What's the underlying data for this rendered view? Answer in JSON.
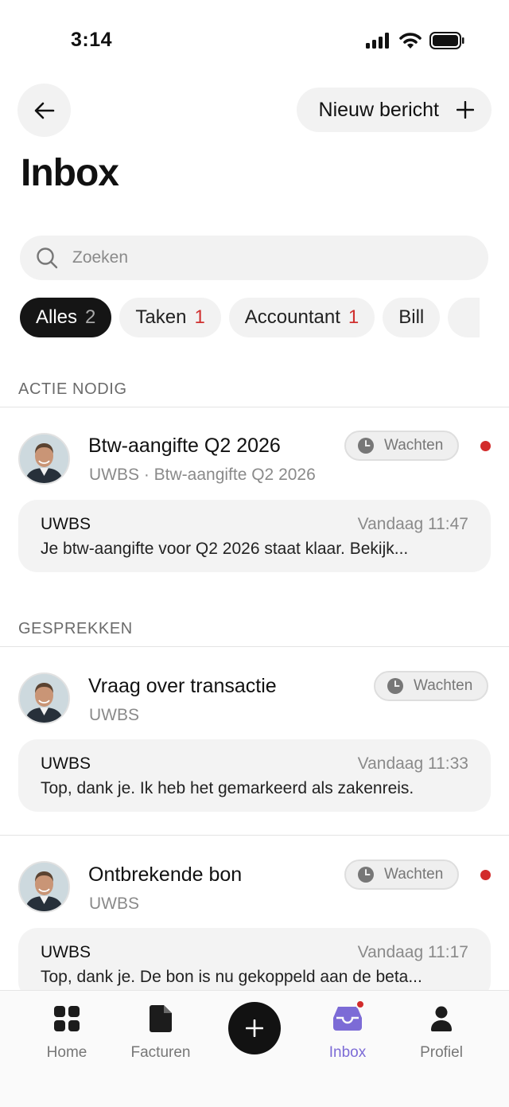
{
  "status_bar": {
    "time": "3:14"
  },
  "header": {
    "back_icon": "arrow-left-icon",
    "new_message_label": "Nieuw bericht",
    "new_message_icon": "plus-icon",
    "title": "Inbox"
  },
  "search": {
    "placeholder": "Zoeken",
    "icon": "search-icon"
  },
  "filters": [
    {
      "label": "Alles",
      "count": "2",
      "active": true
    },
    {
      "label": "Taken",
      "count": "1",
      "active": false
    },
    {
      "label": "Accountant",
      "count": "1",
      "active": false
    },
    {
      "label": "Bill",
      "count": "",
      "active": false
    }
  ],
  "sections": {
    "action_needed": "ACTIE NODIG",
    "conversations": "GESPREKKEN"
  },
  "items": [
    {
      "title": "Btw-aangifte Q2 2026",
      "subtitle": "UWBS · Btw-aangifte Q2 2026",
      "status": "Wachten",
      "unread": true,
      "preview": {
        "sender": "UWBS",
        "time": "Vandaag 11:47",
        "text": "Je btw-aangifte voor Q2 2026 staat klaar. Bekijk..."
      }
    },
    {
      "title": "Vraag over transactie",
      "subtitle": "UWBS",
      "status": "Wachten",
      "unread": false,
      "preview": {
        "sender": "UWBS",
        "time": "Vandaag 11:33",
        "text": "Top, dank je. Ik heb het gemarkeerd als zakenreis."
      }
    },
    {
      "title": "Ontbrekende bon",
      "subtitle": "UWBS",
      "status": "Wachten",
      "unread": true,
      "preview": {
        "sender": "UWBS",
        "time": "Vandaag 11:17",
        "text": "Top, dank je. De bon is nu gekoppeld aan de beta..."
      }
    }
  ],
  "bottom_nav": {
    "home": "Home",
    "invoices": "Facturen",
    "add_icon": "plus-icon",
    "inbox": "Inbox",
    "profile": "Profiel",
    "active": "inbox",
    "accent_color": "#7c6bd6"
  },
  "colors": {
    "unread": "#d22b2b",
    "active_chip": "#151515"
  }
}
